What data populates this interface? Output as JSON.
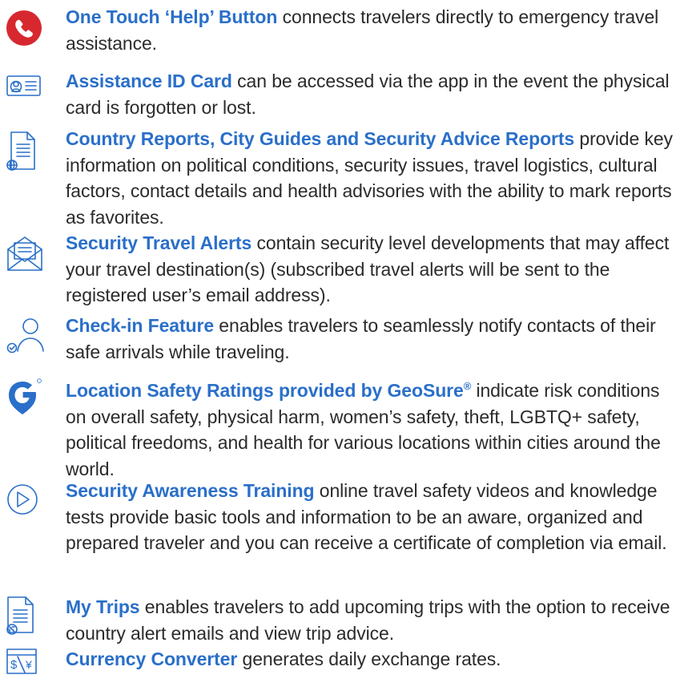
{
  "colors": {
    "accent": "#2a6fc9",
    "help_red": "#d7282f",
    "body_text": "#2b2b2b"
  },
  "features": [
    {
      "icon": "phone-icon",
      "title": "One Touch ‘Help’ Button",
      "desc": " connects travelers directly to emergency travel assistance."
    },
    {
      "icon": "id-card-icon",
      "title": "Assistance ID Card",
      "desc": " can be accessed via the app in the event the physical card is forgotten or lost."
    },
    {
      "icon": "document-globe-icon",
      "title": "Country Reports, City Guides and Security Advice Reports",
      "desc": " provide key information on political conditions, security issues, travel logistics, cultural factors, contact details and health advisories with the ability to mark reports as favorites."
    },
    {
      "icon": "envelope-icon",
      "title": "Security Travel Alerts",
      "desc": " contain security level developments that may affect your travel destination(s) (subscribed travel alerts will be sent to the registered user’s email address)."
    },
    {
      "icon": "person-check-icon",
      "title": "Check-in Feature",
      "desc": " enables travelers to seamlessly notify contacts of their safe arrivals while traveling."
    },
    {
      "icon": "geosure-logo-icon",
      "title": "Location Safety Ratings provided by GeoSure",
      "title_sup": "®",
      "desc": " indicate risk conditions on overall safety, physical harm, women’s safety, theft, LGBTQ+ safety, political freedoms, and health for various locations within cities around the world."
    },
    {
      "icon": "play-icon",
      "title": "Security Awareness Training",
      "desc": " online travel safety videos and knowledge tests provide basic tools and information to be an aware, organized and prepared traveler and you can receive a certificate of completion via email."
    },
    {
      "icon": "document-plane-icon",
      "title": "My Trips",
      "desc": " enables travelers to add upcoming trips with the option to receive country alert emails and view trip advice."
    },
    {
      "icon": "currency-icon",
      "title": "Currency Converter",
      "desc": " generates daily exchange rates."
    }
  ]
}
